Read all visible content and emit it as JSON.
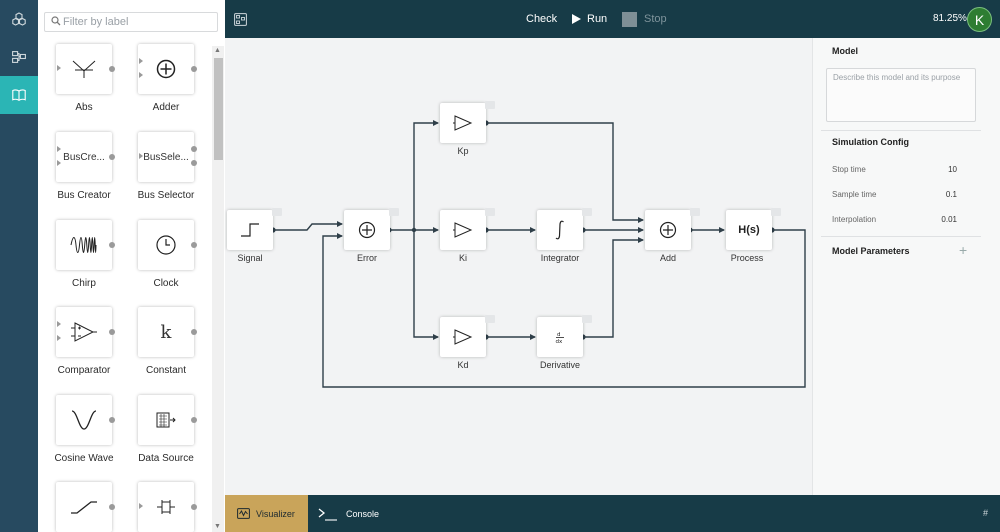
{
  "library": {
    "filter_placeholder": "Filter by label",
    "items": [
      {
        "label": "Abs",
        "icon": "abs-icon"
      },
      {
        "label": "Adder",
        "icon": "adder-icon"
      },
      {
        "label": "Bus Creator",
        "icon": "bus-creator-icon",
        "tile_text": "BusCre..."
      },
      {
        "label": "Bus Selector",
        "icon": "bus-selector-icon",
        "tile_text": "BusSele..."
      },
      {
        "label": "Chirp",
        "icon": "chirp-icon"
      },
      {
        "label": "Clock",
        "icon": "clock-icon"
      },
      {
        "label": "Comparator",
        "icon": "comparator-icon"
      },
      {
        "label": "Constant",
        "icon": "constant-icon",
        "tile_text": "k"
      },
      {
        "label": "Cosine Wave",
        "icon": "cosine-wave-icon"
      },
      {
        "label": "Data Source",
        "icon": "data-source-icon"
      },
      {
        "label": "",
        "icon": "ramp-icon"
      },
      {
        "label": "",
        "icon": "capacitor-icon"
      }
    ]
  },
  "toolbar": {
    "check_label": "Check",
    "run_label": "Run",
    "stop_label": "Stop",
    "zoom": "81.25%",
    "user_initial": "K"
  },
  "canvas": {
    "blocks": {
      "signal": "Signal",
      "error": "Error",
      "kp": "Kp",
      "ki": "Ki",
      "kd": "Kd",
      "integrator": "Integrator",
      "derivative": "Derivative",
      "add": "Add",
      "process": "Process",
      "process_text": "H(s)"
    }
  },
  "properties": {
    "model_header": "Model",
    "description_placeholder": "Describe this model and its purpose",
    "sim_header": "Simulation Config",
    "stop_time_label": "Stop time",
    "stop_time": "10",
    "sample_time_label": "Sample time",
    "sample_time": "0.1",
    "interpolation_label": "Interpolation",
    "interpolation": "0.01",
    "params_header": "Model Parameters"
  },
  "bottom": {
    "visualizer_label": "Visualizer",
    "console_label": "Console",
    "hash": "#"
  },
  "colors": {
    "topbar": "#173b47",
    "rail": "#274a60",
    "rail_active": "#2bb5b5",
    "visualizer_tab": "#c9a45a",
    "avatar": "#2e7d32"
  }
}
